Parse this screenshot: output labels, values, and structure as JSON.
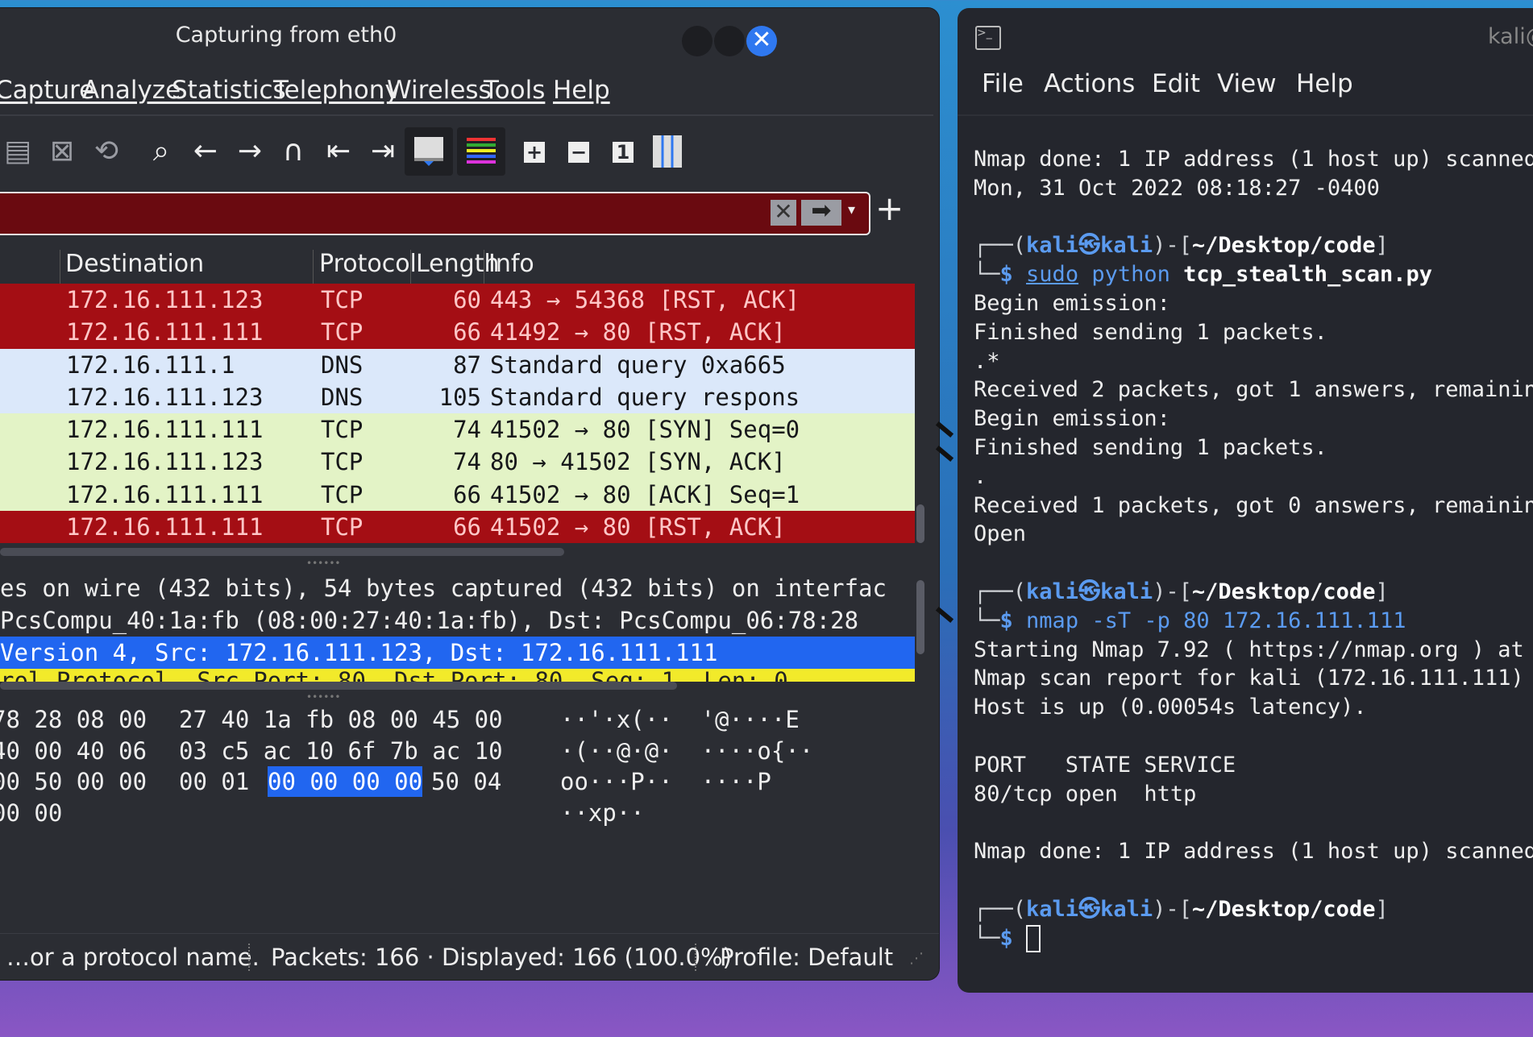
{
  "wireshark": {
    "title": "Capturing from eth0",
    "close_glyph": "✕",
    "menu": [
      "Capture",
      "Analyze",
      "Statistics",
      "Telephony",
      "Wireless",
      "Tools",
      "Help"
    ],
    "filter": {
      "value": "",
      "clear_glyph": "✕",
      "apply_glyph": "➡",
      "dropdown_glyph": "▾",
      "add_glyph": "+"
    },
    "columns": [
      "Destination",
      "Protocol",
      "Length",
      "Info"
    ],
    "packets": [
      {
        "dest": "172.16.111.123",
        "proto": "TCP",
        "len": "60",
        "info": "443 → 54368 [RST, ACK]"
      },
      {
        "dest": "172.16.111.111",
        "proto": "TCP",
        "len": "66",
        "info": "41492 → 80 [RST, ACK]"
      },
      {
        "dest": "172.16.111.1",
        "proto": "DNS",
        "len": "87",
        "info": "Standard query 0xa665"
      },
      {
        "dest": "172.16.111.123",
        "proto": "DNS",
        "len": "105",
        "info": "Standard query respons"
      },
      {
        "dest": "172.16.111.111",
        "proto": "TCP",
        "len": "74",
        "info": "41502 → 80 [SYN] Seq=0"
      },
      {
        "dest": "172.16.111.123",
        "proto": "TCP",
        "len": "74",
        "info": "80 → 41502 [SYN, ACK]"
      },
      {
        "dest": "172.16.111.111",
        "proto": "TCP",
        "len": "66",
        "info": "41502 → 80 [ACK] Seq=1"
      },
      {
        "dest": "172.16.111.111",
        "proto": "TCP",
        "len": "66",
        "info": "41502 → 80 [RST, ACK]"
      }
    ],
    "details": [
      "es on wire (432 bits), 54 bytes captured (432 bits) on interfac",
      " PcsCompu_40:1a:fb (08:00:27:40:1a:fb), Dst: PcsCompu_06:78:28",
      " Version 4, Src: 172.16.111.123, Dst: 172.16.111.111",
      "rol Protocol, Src Port: 80, Dst Port: 80, Seq: 1, Len: 0"
    ],
    "bytes": [
      {
        "hex1": "78 28 08 00",
        "hex2": "27 40 1a fb 08 00 45 00",
        "hl": "",
        "hex3": "",
        "ascii": "··'·x(··  '@····E"
      },
      {
        "hex1": "40 00 40 06",
        "hex2": "03 c5 ac 10 6f 7b ac 10",
        "hl": "",
        "hex3": "",
        "ascii": "·(··@·@·  ····o{··"
      },
      {
        "hex1": "00 50 00 00",
        "hex2": "00 01",
        "hl": "00 00 00 00",
        "hex3": "50 04",
        "ascii": "oo···P··  ····P"
      },
      {
        "hex1": "00 00",
        "hex2": "",
        "hl": "",
        "hex3": "",
        "ascii": "··xp··"
      }
    ],
    "status": {
      "hint": "…or a protocol name.",
      "packets": "Packets: 166 · Displayed: 166 (100.0%)",
      "profile": "Profile: Default"
    }
  },
  "terminal": {
    "title": "kali@",
    "menu": [
      "File",
      "Actions",
      "Edit",
      "View",
      "Help"
    ],
    "lines": {
      "l1": "Nmap done: 1 IP address (1 host up) scanned",
      "l2": "Mon, 31 Oct 2022 08:18:27 -0400",
      "p1_user": "kali",
      "p1_host": "kali",
      "p1_path": "~/Desktop/code",
      "cmd1_sudo": "sudo",
      "cmd1_prog": "python",
      "cmd1_arg": "tcp_stealth_scan.py",
      "o1": "Begin emission:",
      "o2": "Finished sending 1 packets.",
      "o3": ".*",
      "o4": "Received 2 packets, got 1 answers, remainin",
      "o5": "Begin emission:",
      "o6": "Finished sending 1 packets.",
      "o7": ".",
      "o8": "Received 1 packets, got 0 answers, remainin",
      "o9": "Open",
      "cmd2": "nmap -sT -p 80 172.16.111.111",
      "n1": "Starting Nmap 7.92 ( https://nmap.org ) at",
      "n2": "Nmap scan report for kali (172.16.111.111)",
      "n3": "Host is up (0.00054s latency).",
      "n4": "PORT   STATE SERVICE",
      "n5": "80/tcp open  http",
      "n6": "Nmap done: 1 IP address (1 host up) scanned"
    },
    "prompt_symbol": "$",
    "kali_symbol": "㉿"
  }
}
